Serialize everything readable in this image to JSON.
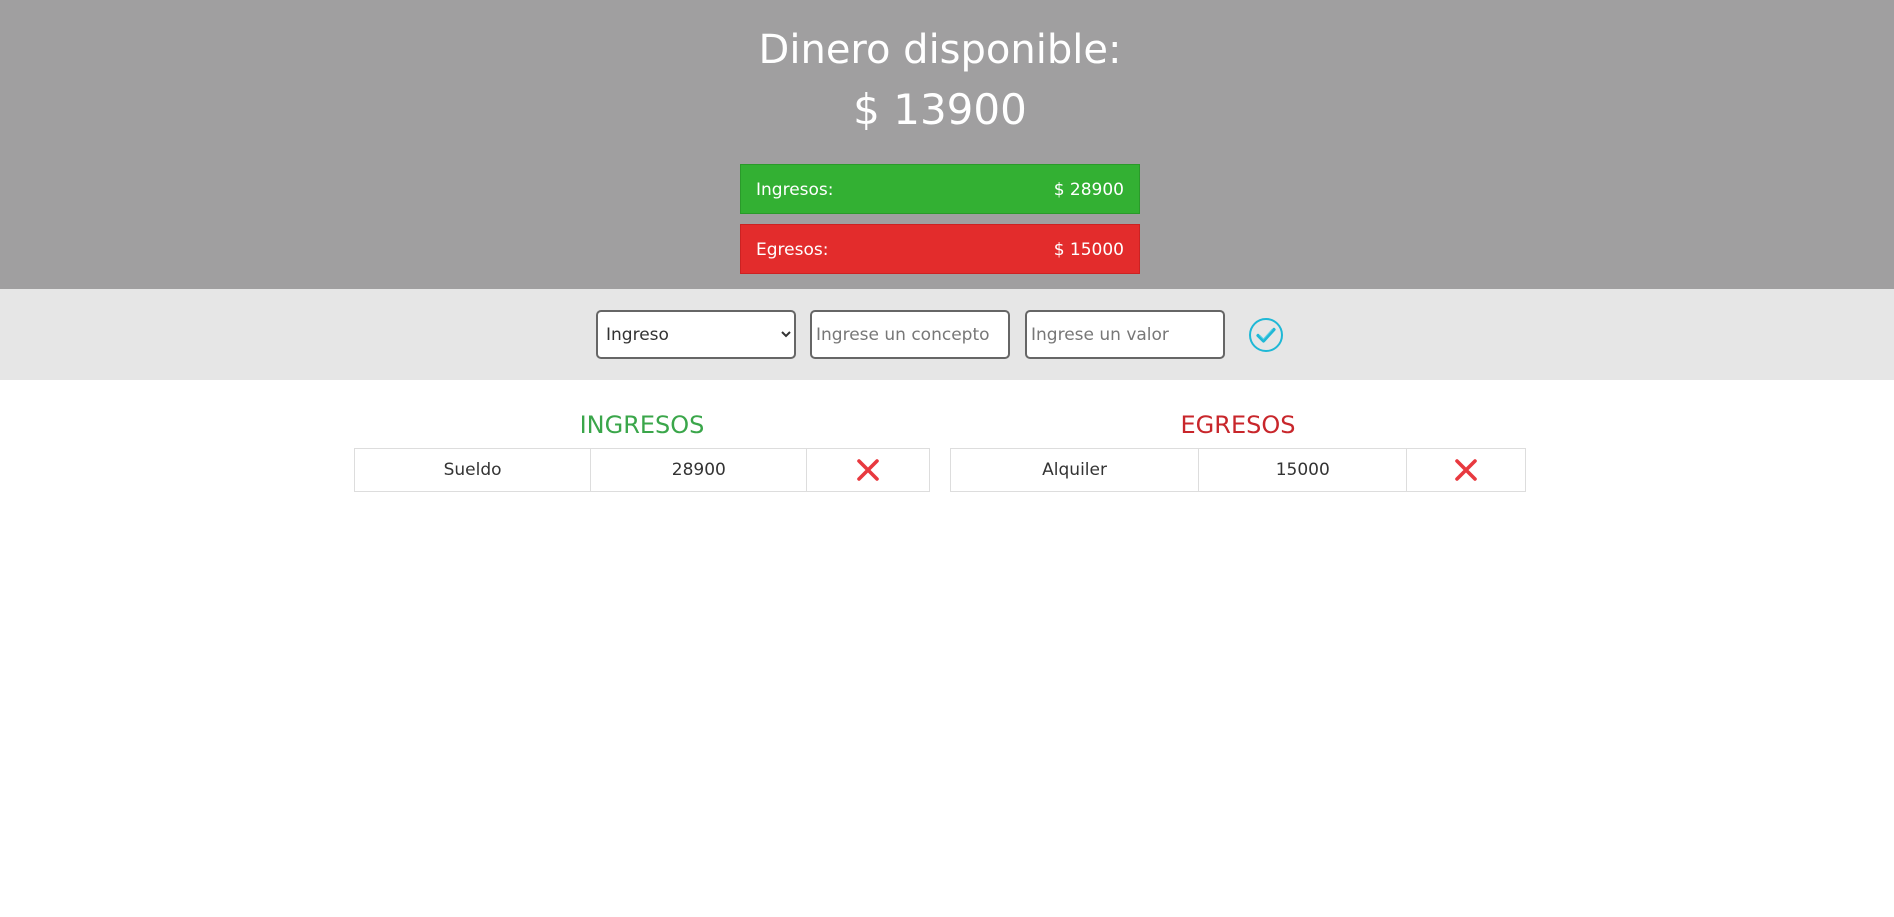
{
  "header": {
    "title": "Dinero disponible:",
    "total": "$ 13900",
    "income_bar": {
      "label": "Ingresos:",
      "value": "$ 28900",
      "color": "#33b033"
    },
    "expense_bar": {
      "label": "Egresos:",
      "value": "$ 15000",
      "color": "#e32c2c"
    }
  },
  "form": {
    "type_select": {
      "selected": "Ingreso",
      "options": [
        "Ingreso"
      ]
    },
    "concept_placeholder": "Ingrese un concepto",
    "value_placeholder": "Ingrese un valor",
    "submit_icon": "check-circle-icon",
    "accent_color": "#1fb8d6"
  },
  "incomes": {
    "title": "INGRESOS",
    "color": "#3aa64a",
    "rows": [
      {
        "concept": "Sueldo",
        "value": "28900",
        "delete_icon": "close-icon"
      }
    ]
  },
  "expenses": {
    "title": "EGRESOS",
    "color": "#c8262b",
    "rows": [
      {
        "concept": "Alquiler",
        "value": "15000",
        "delete_icon": "close-icon"
      }
    ]
  }
}
